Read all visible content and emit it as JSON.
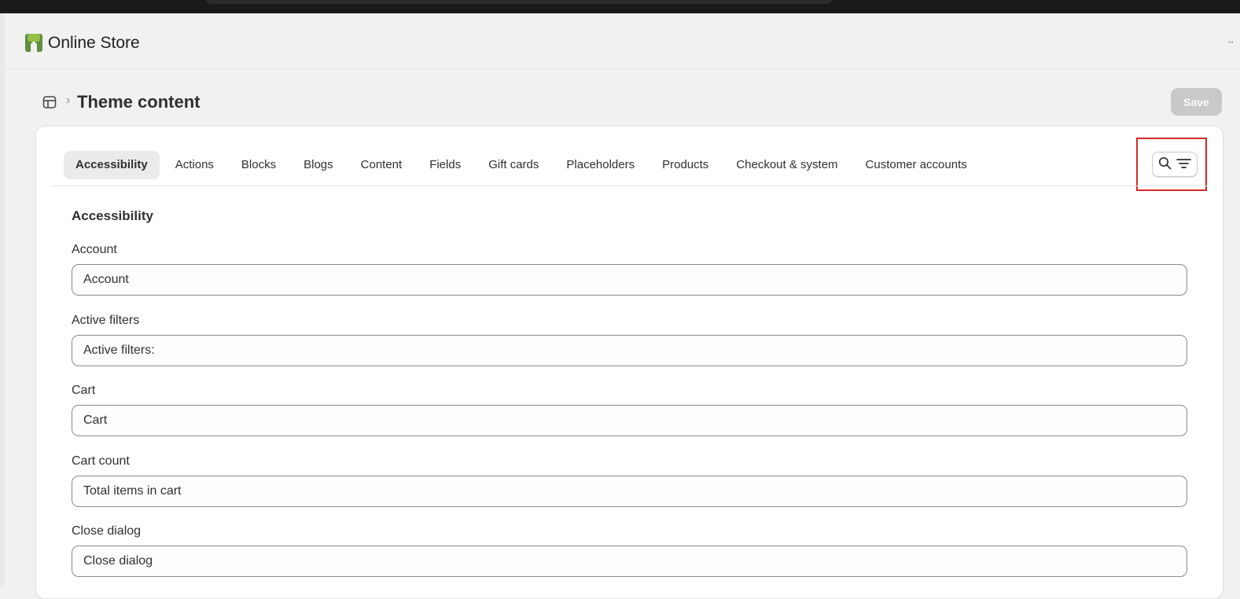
{
  "app": {
    "title": "Online Store",
    "more_label": "··"
  },
  "header": {
    "title": "Theme content",
    "separator": "›",
    "save_label": "Save"
  },
  "tabs": [
    {
      "label": "Accessibility",
      "active": true
    },
    {
      "label": "Actions"
    },
    {
      "label": "Blocks"
    },
    {
      "label": "Blogs"
    },
    {
      "label": "Content"
    },
    {
      "label": "Fields"
    },
    {
      "label": "Gift cards"
    },
    {
      "label": "Placeholders"
    },
    {
      "label": "Products"
    },
    {
      "label": "Checkout & system"
    },
    {
      "label": "Customer accounts"
    }
  ],
  "section": {
    "heading": "Accessibility",
    "fields": [
      {
        "label": "Account",
        "value": "Account"
      },
      {
        "label": "Active filters",
        "value": "Active filters:"
      },
      {
        "label": "Cart",
        "value": "Cart"
      },
      {
        "label": "Cart count",
        "value": "Total items in cart"
      },
      {
        "label": "Close dialog",
        "value": "Close dialog"
      }
    ]
  },
  "icons": {
    "app_logo": "store-logo-icon",
    "theme": "theme-icon",
    "search": "search-icon",
    "filter": "filter-lines-icon"
  },
  "colors": {
    "highlight": "#d42a2a",
    "logo_green": "#5e8e3e",
    "save_disabled": "#c9c9c9"
  }
}
